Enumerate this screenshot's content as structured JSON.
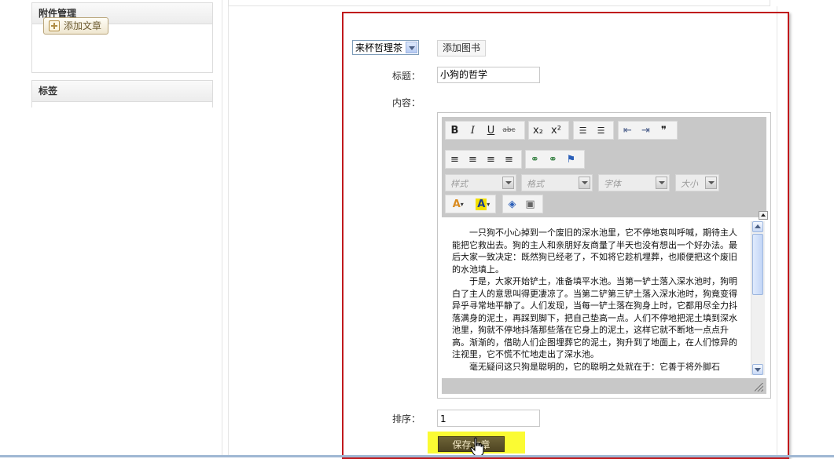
{
  "sidebar": {
    "attachments_panel": {
      "title": "附件管理",
      "add_article_label": "添加文章"
    },
    "tags_panel": {
      "title": "标签"
    }
  },
  "form": {
    "book_select": {
      "selected": "来杯哲理茶"
    },
    "add_book_label": "添加图书",
    "title_label": "标题：",
    "title_value": "小狗的哲学",
    "content_label": "内容：",
    "order_label": "排序：",
    "order_value": "1",
    "save_label": "保存文章"
  },
  "editor": {
    "toolbar_row1": [
      {
        "icon": "bold-icon",
        "glyph": "B"
      },
      {
        "icon": "italic-icon",
        "glyph": "I"
      },
      {
        "icon": "underline-icon",
        "glyph": "U"
      },
      {
        "icon": "strikethrough-icon",
        "glyph": "abc"
      },
      {
        "icon": "subscript-icon",
        "glyph": "x₂"
      },
      {
        "icon": "superscript-icon",
        "glyph": "x²"
      },
      {
        "icon": "numbered-list-icon",
        "glyph": "☰"
      },
      {
        "icon": "bulleted-list-icon",
        "glyph": "☰"
      },
      {
        "icon": "outdent-icon",
        "glyph": "⇤"
      },
      {
        "icon": "indent-icon",
        "glyph": "⇥"
      },
      {
        "icon": "blockquote-icon",
        "glyph": "❞"
      }
    ],
    "toolbar_row2": [
      {
        "icon": "align-left-icon",
        "glyph": "≡"
      },
      {
        "icon": "align-center-icon",
        "glyph": "≡"
      },
      {
        "icon": "align-right-icon",
        "glyph": "≡"
      },
      {
        "icon": "align-justify-icon",
        "glyph": "≡"
      },
      {
        "icon": "link-icon",
        "glyph": "⚭"
      },
      {
        "icon": "unlink-icon",
        "glyph": "⚭"
      },
      {
        "icon": "anchor-flag-icon",
        "glyph": "⚑"
      }
    ],
    "combos": {
      "style": "样式",
      "format": "格式",
      "font": "字体",
      "size": "大小"
    },
    "toolbar_row4": [
      {
        "icon": "text-color-icon",
        "glyph": "A"
      },
      {
        "icon": "background-color-icon",
        "glyph": "A"
      },
      {
        "icon": "maximize-icon",
        "glyph": "◈"
      },
      {
        "icon": "show-blocks-icon",
        "glyph": "▣"
      }
    ],
    "paragraphs": [
      "一只狗不小心掉到一个废旧的深水池里，它不停地哀叫呼喊，期待主人能把它救出去。狗的主人和亲朋好友商量了半天也没有想出一个好办法。最后大家一致决定：既然狗已经老了，不如将它趁机埋葬，也顺便把这个废旧的水池填上。",
      "于是，大家开始铲土，准备填平水池。当第一铲土落入深水池时，狗明白了主人的意思叫得更凄凉了。当第二铲第三铲土落入深水池时，狗竟变得异乎寻常地平静了。人们发现，当每一铲土落在狗身上时，它都用尽全力抖落满身的泥土，再踩到脚下，把自己垫高一点。人们不停地把泥土填到深水池里，狗就不停地抖落那些落在它身上的泥土，这样它就不断地一点点升高。渐渐的，借助人们企图埋葬它的泥土，狗升到了地面上，在人们惊异的注视里，它不慌不忙地走出了深水池。",
      "毫无疑问这只狗是聪明的，它的聪明之处就在于：它善于将外脚石"
    ]
  },
  "colors": {
    "highlight_border": "#c0181c",
    "save_highlight": "#fbfb33",
    "save_button": "#5d5329"
  }
}
